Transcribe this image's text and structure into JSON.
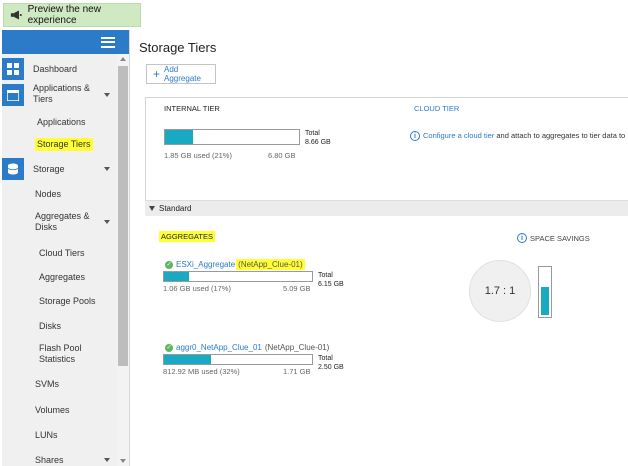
{
  "banner": {
    "label": "Preview the new experience"
  },
  "sidebar": {
    "items": [
      {
        "label": "Dashboard"
      },
      {
        "label": "Applications & Tiers"
      },
      {
        "label": "Applications"
      },
      {
        "label": "Storage Tiers"
      },
      {
        "label": "Storage"
      },
      {
        "label": "Nodes"
      },
      {
        "label": "Aggregates & Disks"
      },
      {
        "label": "Cloud Tiers"
      },
      {
        "label": "Aggregates"
      },
      {
        "label": "Storage Pools"
      },
      {
        "label": "Disks"
      },
      {
        "label": "Flash Pool Statistics"
      },
      {
        "label": "SVMs"
      },
      {
        "label": "Volumes"
      },
      {
        "label": "LUNs"
      },
      {
        "label": "Shares"
      }
    ]
  },
  "main": {
    "title": "Storage Tiers",
    "add_button": "Add Aggregate",
    "internal_tier": {
      "label": "INTERNAL TIER",
      "used": "1.85 GB used (21%)",
      "available": "6.80 GB",
      "total_label": "Total",
      "total_value": "8.66 GB",
      "fill_percent": 21
    },
    "cloud_tier": {
      "label": "CLOUD TIER",
      "link": "Configure a cloud tier",
      "text": "and attach to aggregates to tier data to"
    },
    "standard": {
      "label": "Standard",
      "aggregates_heading": "AGGREGATES",
      "aggregates": [
        {
          "name": "ESXi_Aggregate",
          "node": "(NetApp_Clue-01)",
          "used": "1.06 GB used (17%)",
          "available": "5.09 GB",
          "total_label": "Total",
          "total_value": "6.15 GB",
          "fill_percent": 17
        },
        {
          "name": "aggr0_NetApp_Clue_01",
          "node": "(NetApp_Clue-01)",
          "used": "812.92 MB used (32%)",
          "available": "1.71 GB",
          "total_label": "Total",
          "total_value": "2.50 GB",
          "fill_percent": 32
        }
      ],
      "space_savings_label": "SPACE SAVINGS",
      "ratio": "1.7 : 1"
    }
  },
  "colors": {
    "accent": "#2b7bc9",
    "fill": "#1aa9c2",
    "highlight": "#ffff33",
    "banner": "#cfe9c2"
  }
}
